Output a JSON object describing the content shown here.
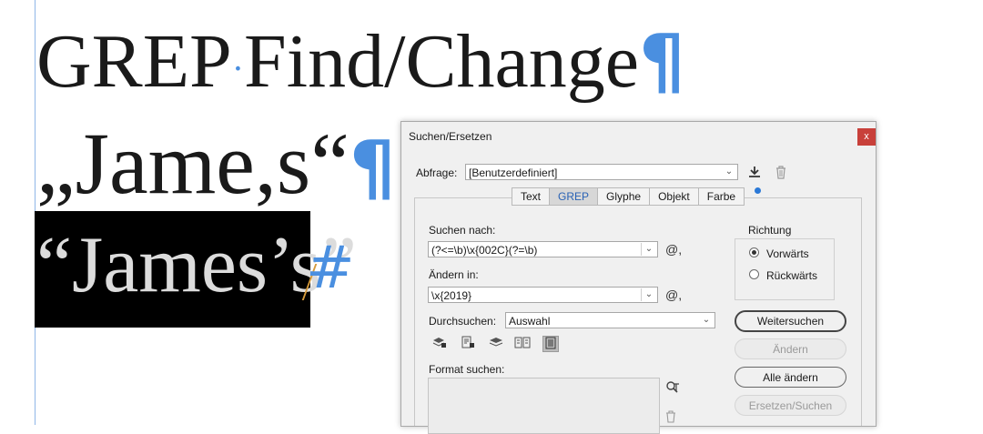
{
  "document": {
    "line1": "GREP",
    "line1_b": "Find/Change",
    "line2": "„Jame,s“",
    "line3": "“James’s”",
    "pilcrow": "¶",
    "space_marker": "·",
    "end_marker": "#"
  },
  "dialog": {
    "title": "Suchen/Ersetzen",
    "close_label": "x",
    "query_label": "Abfrage:",
    "query_value": "[Benutzerdefiniert]",
    "tabs": [
      {
        "label": "Text",
        "active": false
      },
      {
        "label": "GREP",
        "active": true
      },
      {
        "label": "Glyphe",
        "active": false
      },
      {
        "label": "Objekt",
        "active": false
      },
      {
        "label": "Farbe",
        "active": false
      }
    ],
    "find_label": "Suchen nach:",
    "find_value": "(?<=\\b)\\x{002C}(?=\\b)",
    "change_label": "Ändern in:",
    "change_value": "\\x{2019}",
    "search_label": "Durchsuchen:",
    "search_value": "Auswahl",
    "format_label": "Format suchen:",
    "direction": {
      "title": "Richtung",
      "forward": "Vorwärts",
      "backward": "Rückwärts",
      "selected": "Vorwärts"
    },
    "buttons": {
      "find_next": "Weitersuchen",
      "change": "Ändern",
      "change_all": "Alle ändern",
      "change_find": "Ersetzen/Suchen"
    },
    "special_char_glyph": "@,",
    "accent_color": "#2b79d7"
  }
}
